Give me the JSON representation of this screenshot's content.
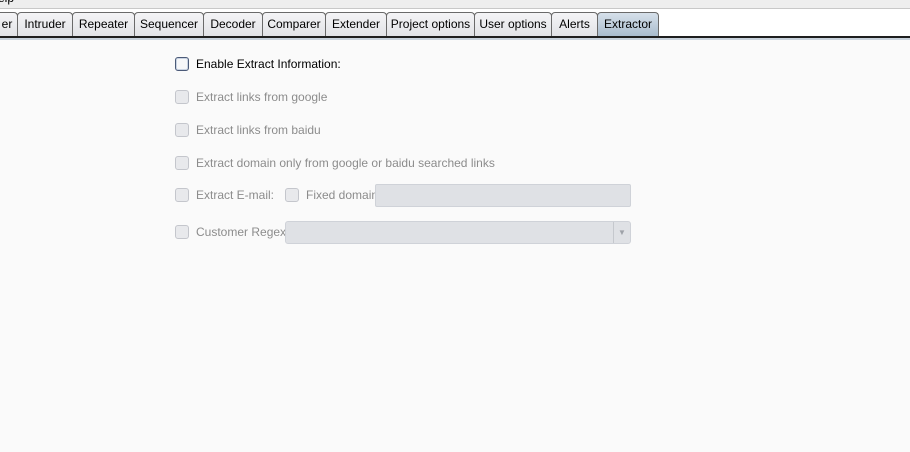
{
  "menubar": {
    "partial_label": "elp"
  },
  "tabs": [
    {
      "label": "er"
    },
    {
      "label": "Intruder"
    },
    {
      "label": "Repeater"
    },
    {
      "label": "Sequencer"
    },
    {
      "label": "Decoder"
    },
    {
      "label": "Comparer"
    },
    {
      "label": "Extender"
    },
    {
      "label": "Project options"
    },
    {
      "label": "User options"
    },
    {
      "label": "Alerts"
    },
    {
      "label": "Extractor",
      "active": true
    }
  ],
  "options": {
    "enable": {
      "label": "Enable Extract Information:",
      "checked": false
    },
    "google": {
      "label": "Extract links from google",
      "checked": false
    },
    "baidu": {
      "label": "Extract links from baidu",
      "checked": false
    },
    "domain_only": {
      "label": "Extract domain only from google or baidu searched links",
      "checked": false
    },
    "email": {
      "label": "Extract E-mail:",
      "checked": false
    },
    "fixed_domain": {
      "label": "Fixed domain",
      "checked": false,
      "value": ""
    },
    "regex": {
      "label": "Customer Regex:",
      "checked": false,
      "selected": ""
    }
  }
}
